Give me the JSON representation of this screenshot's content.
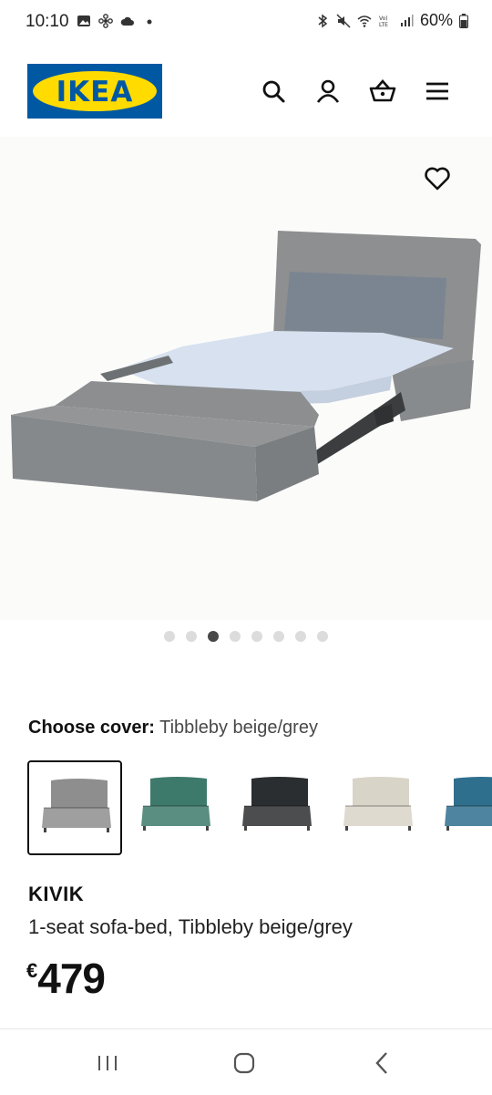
{
  "status_bar": {
    "time": "10:10",
    "battery": "60%",
    "left_icons": [
      "image-icon",
      "flower-icon",
      "cloud-icon",
      "dot-icon"
    ],
    "right_icons": [
      "bluetooth-icon",
      "mute-icon",
      "wifi-icon",
      "volte-icon",
      "signal-icon",
      "battery-icon"
    ]
  },
  "header": {
    "logo_text": "IKEA",
    "icons": [
      "search-icon",
      "account-icon",
      "basket-icon",
      "menu-icon"
    ]
  },
  "gallery": {
    "total_images": 8,
    "active_index": 2
  },
  "cover": {
    "label": "Choose cover:",
    "value": "Tibbleby beige/grey",
    "options": [
      {
        "color": "#8e8e8e",
        "selected": true
      },
      {
        "color": "#3d7a6b",
        "selected": false
      },
      {
        "color": "#2b2e30",
        "selected": false
      },
      {
        "color": "#d9d4c8",
        "selected": false
      },
      {
        "color": "#2f6f8e",
        "selected": false
      }
    ]
  },
  "product": {
    "name": "KIVIK",
    "description": "1-seat sofa-bed, Tibbleby beige/grey",
    "currency": "€",
    "price": "479"
  },
  "nav_bar": {
    "icons": [
      "recent-apps-icon",
      "home-icon",
      "back-icon"
    ]
  }
}
